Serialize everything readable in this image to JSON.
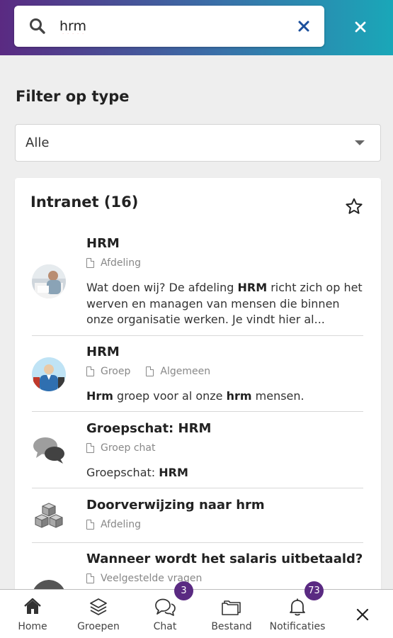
{
  "search": {
    "value": "hrm",
    "placeholder": ""
  },
  "filter": {
    "title": "Filter op type",
    "selected": "Alle"
  },
  "results_section": {
    "title": "Intranet (16)",
    "items": [
      {
        "title": "HRM",
        "meta": [
          "Afdeling"
        ],
        "desc": [
          {
            "t": "Wat doen wij? De afdeling ",
            "b": false
          },
          {
            "t": "HRM",
            "b": true
          },
          {
            "t": " richt zich op het werven en managen van mensen die binnen onze organisatie werken. Je vindt hier al...",
            "b": false
          }
        ]
      },
      {
        "title": "HRM",
        "meta": [
          "Groep",
          "Algemeen"
        ],
        "desc": [
          {
            "t": "Hrm",
            "b": true
          },
          {
            "t": " groep voor al onze ",
            "b": false
          },
          {
            "t": "hrm",
            "b": true
          },
          {
            "t": " mensen.",
            "b": false
          }
        ]
      },
      {
        "title": "Groepschat: HRM",
        "meta": [
          "Groep chat"
        ],
        "desc": [
          {
            "t": "Groepschat: ",
            "b": false
          },
          {
            "t": "HRM",
            "b": true
          }
        ]
      },
      {
        "title": "Doorverwijzing naar hrm",
        "meta": [
          "Afdeling"
        ],
        "desc": []
      },
      {
        "title": "Wanneer wordt het salaris uitbetaald?",
        "meta": [
          "Veelgestelde vragen"
        ],
        "desc": []
      }
    ]
  },
  "bottom_nav": {
    "home": "Home",
    "groups": "Groepen",
    "chat": "Chat",
    "chat_badge": "3",
    "files": "Bestand",
    "notifications": "Notificaties",
    "notifications_badge": "73"
  },
  "colors": {
    "brand_purple": "#5a2a82",
    "brand_teal": "#1aa7b8",
    "clear_icon_blue": "#1b4f9c"
  },
  "icons": [
    "search-icon",
    "clear-icon",
    "close-icon",
    "chevron-down-icon",
    "star-icon",
    "document-icon",
    "home-icon",
    "layers-icon",
    "chat-icon",
    "folder-icon",
    "bell-icon"
  ]
}
